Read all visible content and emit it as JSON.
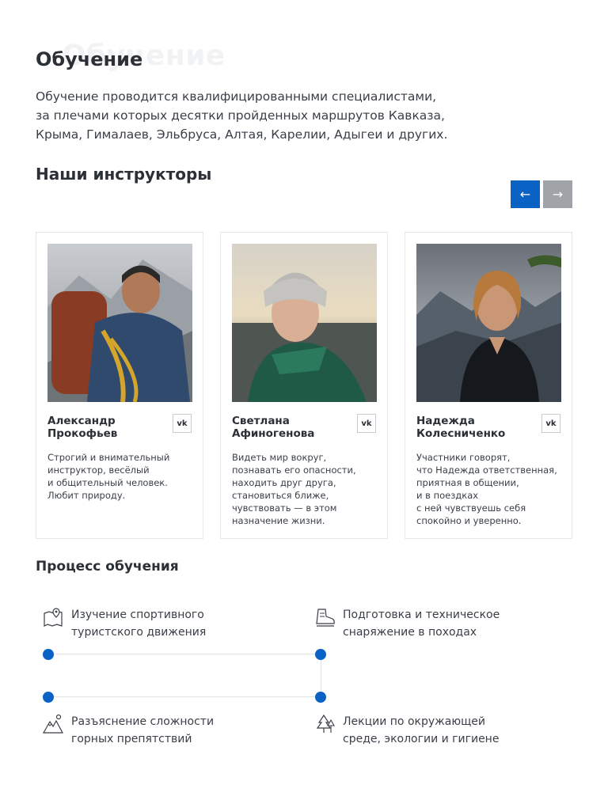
{
  "header": {
    "ghost_title": "Обучение",
    "title": "Обучение",
    "intro_lines": [
      "Обучение проводится квалифицированными специалистами,",
      "за плечами которых десятки пройденных маршрутов Кавказа,",
      "Крыма, Гималаев, Эльбруса, Алтая, Карелии, Адыгеи и других."
    ]
  },
  "instructors": {
    "title": "Наши инструкторы",
    "prev_label": "←",
    "next_label": "→",
    "cards": [
      {
        "name_lines": [
          "Александр",
          "Прокофьев"
        ],
        "social": "vk",
        "desc_lines": [
          "Строгий и внимательный",
          "инструктор, весёлый",
          "и общительный человек.",
          "Любит природу."
        ]
      },
      {
        "name_lines": [
          "Светлана",
          "Афиногенова"
        ],
        "social": "vk",
        "desc_lines": [
          "Видеть мир вокруг,",
          "познавать его опасности,",
          "находить друг друга,",
          "становиться ближе,",
          "чувствовать — в этом",
          "назначение жизни."
        ]
      },
      {
        "name_lines": [
          "Надежда",
          "Колесниченко"
        ],
        "social": "vk",
        "desc_lines": [
          "Участники говорят,",
          "что Надежда ответственная,",
          "приятная в общении,",
          "и в поездках",
          "с ней чувствуешь себя",
          "спокойно и уверенно."
        ]
      }
    ]
  },
  "process": {
    "title": "Процесс обучения",
    "items": [
      {
        "icon": "map-pin-icon",
        "lines": [
          "Изучение спортивного",
          "туристского движения"
        ]
      },
      {
        "icon": "hiking-boot-icon",
        "lines": [
          "Подготовка и техническое",
          "снаряжение в походах"
        ]
      },
      {
        "icon": "mountains-icon",
        "lines": [
          "Разъяснение сложности",
          "горных препятствий"
        ]
      },
      {
        "icon": "trees-icon",
        "lines": [
          "Лекции по окружающей",
          "среде, экологии и гигиене"
        ]
      }
    ]
  },
  "colors": {
    "accent": "#0a62c5",
    "arrow_inactive": "#a0a3a8",
    "text": "#2b2f36"
  }
}
